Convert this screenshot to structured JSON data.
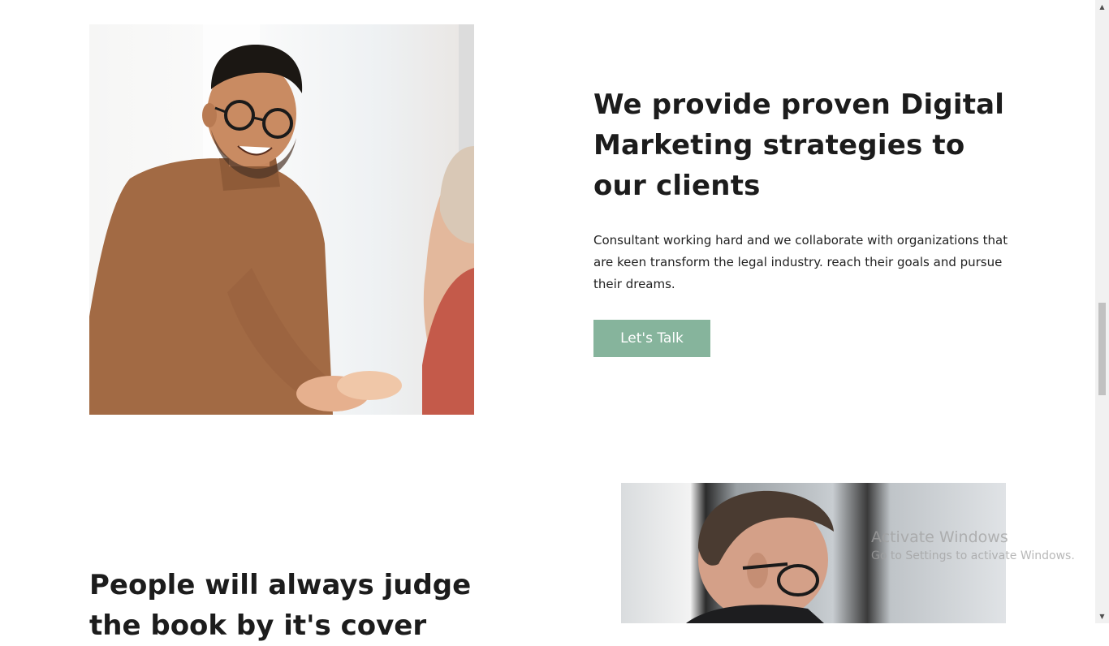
{
  "section1": {
    "photo_alt": "Man in brown sweater shaking hands",
    "headline": "We provide proven Digital Marketing strategies to our clients",
    "body": "Consultant working hard and we collaborate with organizations that are keen transform the legal industry. reach their goals and pursue their dreams.",
    "cta_label": "Let's Talk"
  },
  "section2": {
    "headline": "People will always judge the book by it's cover",
    "photo_alt": "Man with glasses working in office"
  },
  "colors": {
    "accent": "#86b49c",
    "heading": "#1c1c1c",
    "background": "#ffffff"
  },
  "watermark": {
    "title": "Activate Windows",
    "subtitle": "Go to Settings to activate Windows."
  }
}
